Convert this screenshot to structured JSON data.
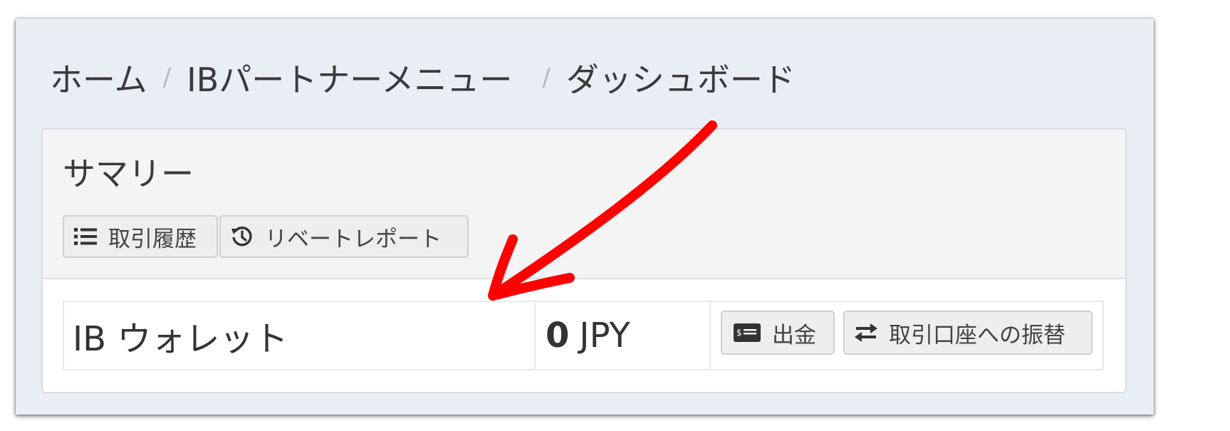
{
  "breadcrumb": {
    "home": "ホーム",
    "separator": "/",
    "ib_menu": "IBパートナーメニュー",
    "current": "ダッシュボード"
  },
  "summary": {
    "title": "サマリー",
    "history_button": "取引履歴",
    "rebate_button": "リベートレポート"
  },
  "wallet": {
    "name": "IB ウォレット",
    "amount": "0",
    "currency": "JPY",
    "withdraw_button": "出金",
    "transfer_button": "取引口座への振替"
  },
  "annotation": {
    "arrow_color": "#ff0000"
  },
  "icons": {
    "history": "list-icon",
    "rebate": "history-clock-icon",
    "withdraw": "money-check-icon",
    "transfer": "exchange-arrows-icon"
  }
}
